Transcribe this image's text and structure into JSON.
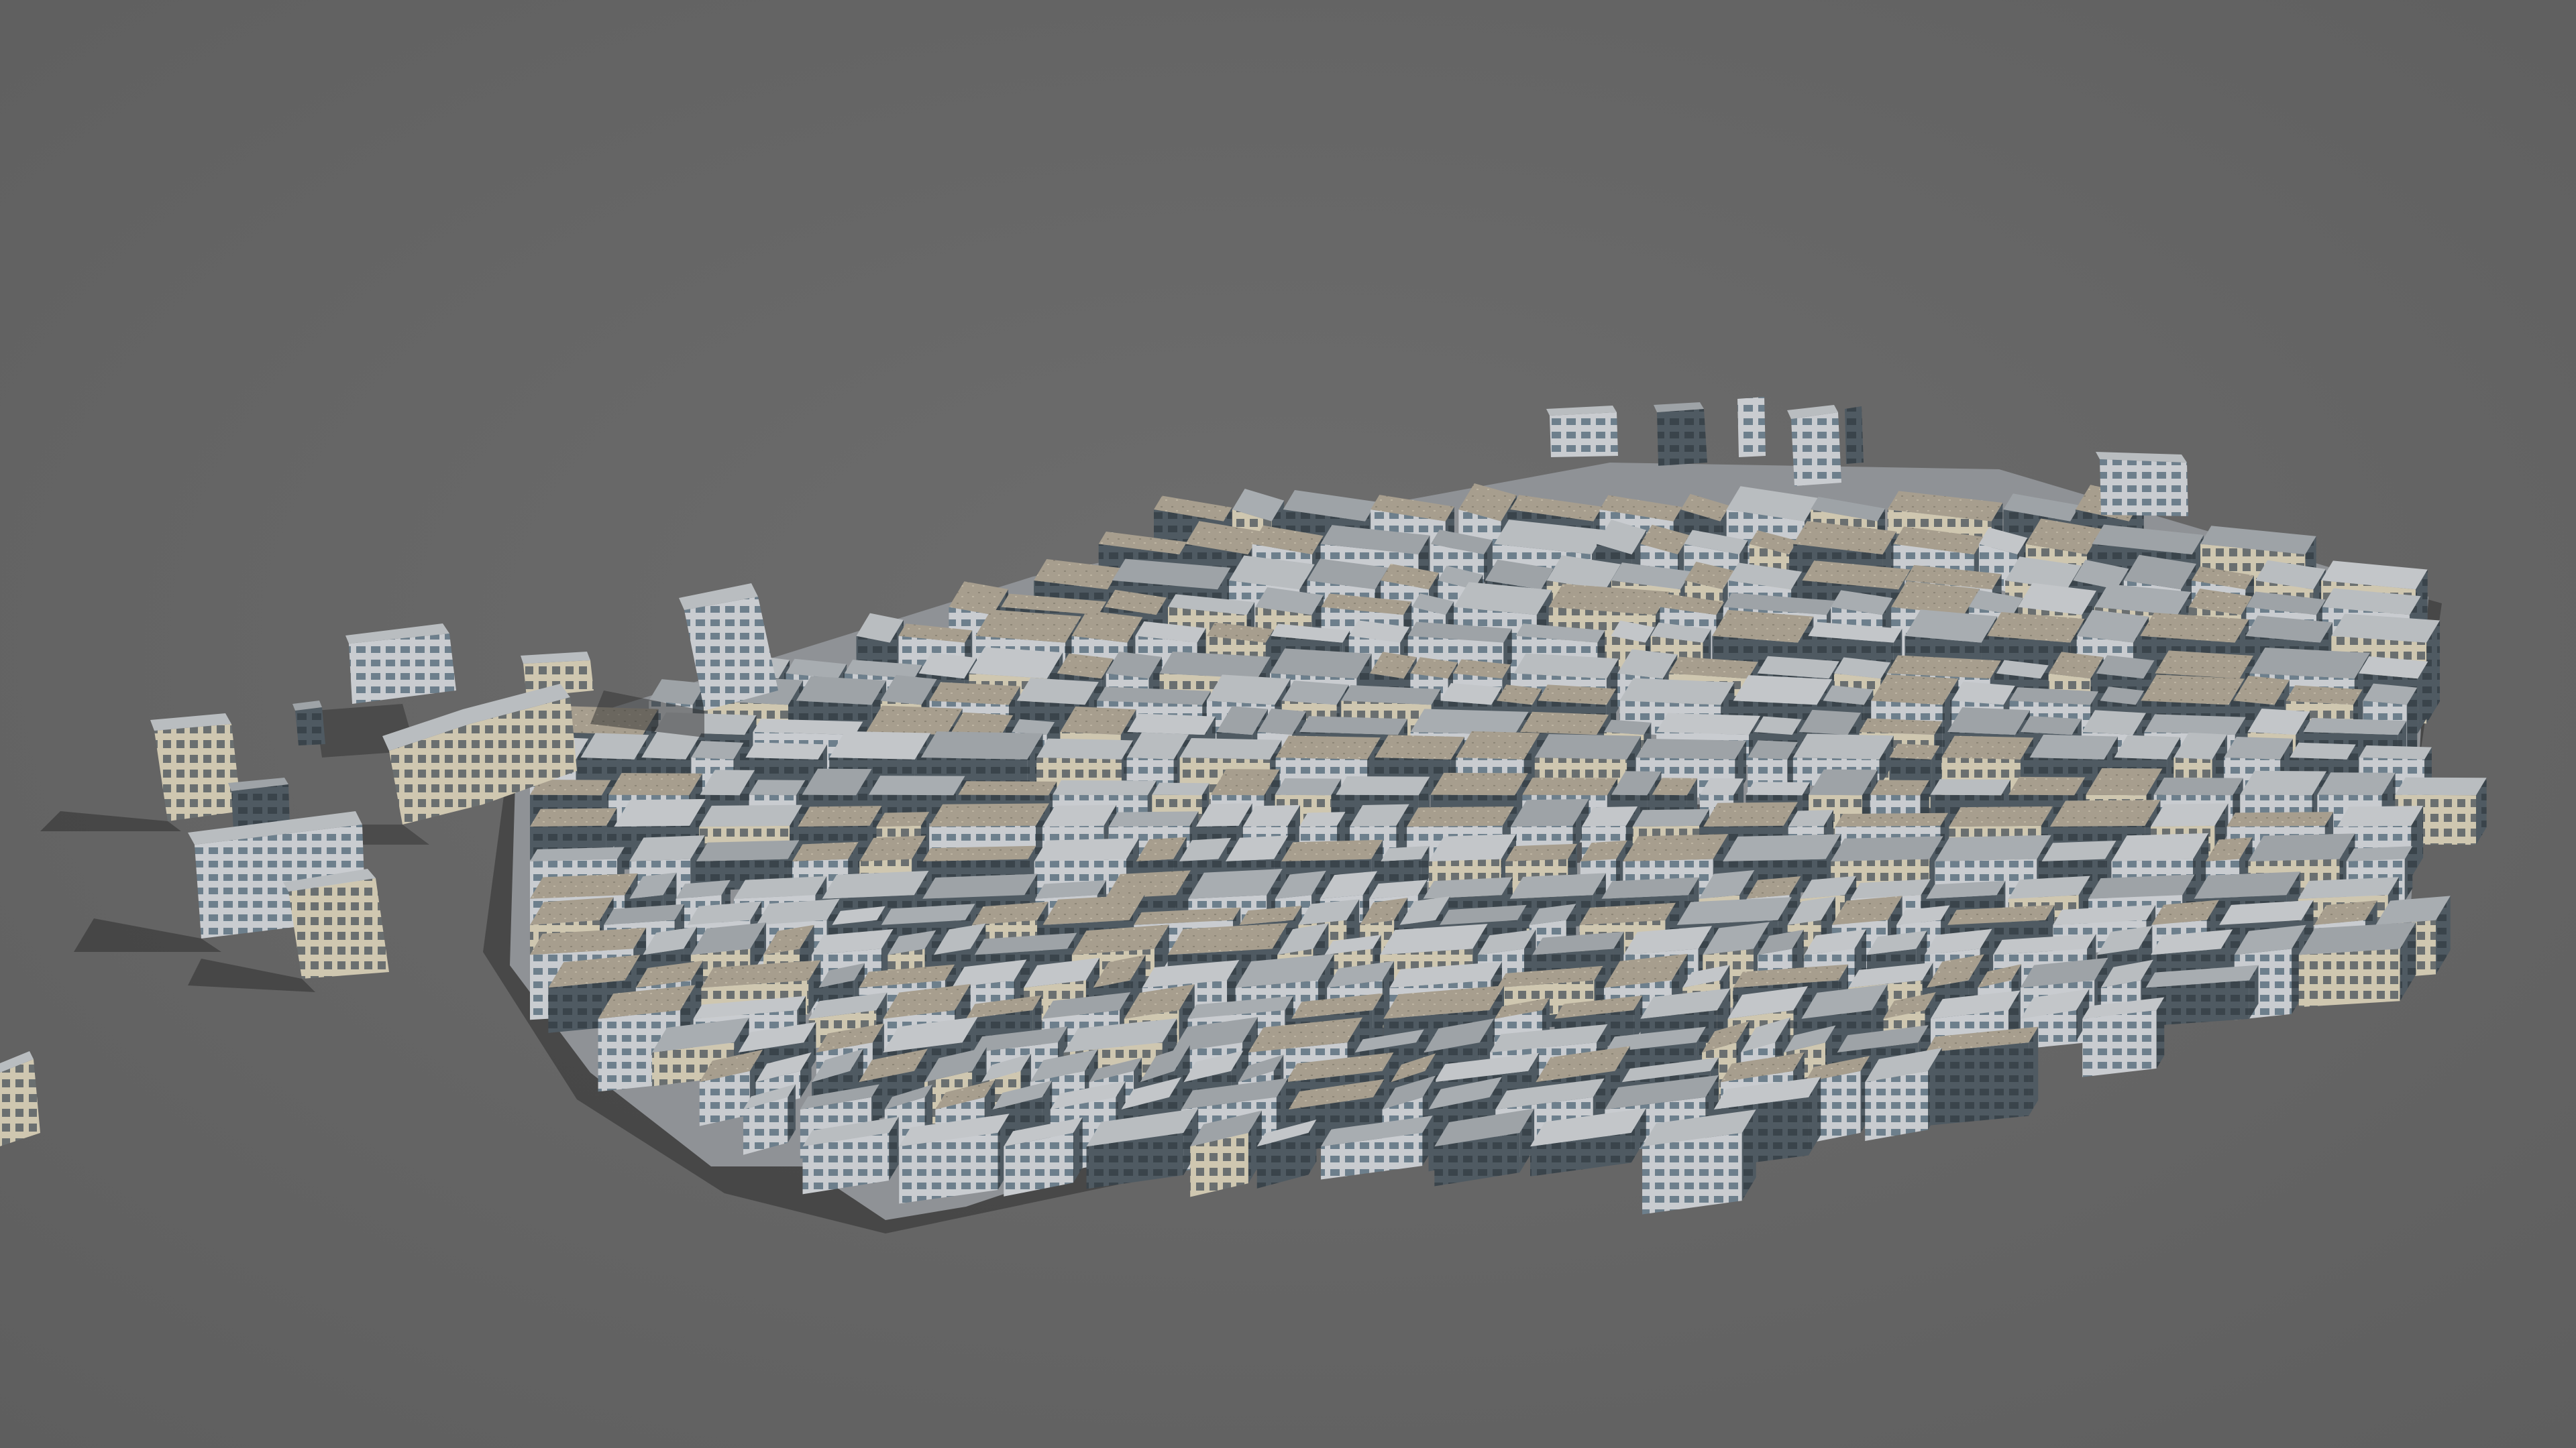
{
  "scene": {
    "description_free": true,
    "colors": {
      "background": "#686868",
      "background_dark": "#5c5c5c",
      "shadow": "#2a2a2a",
      "ground": "#8f9296",
      "roof_light": "#b9bdc0",
      "roof_mid": "#9ea3a7",
      "wall_lit": "#c9ccd0",
      "wall_dark": "#4f5a62",
      "window_tint": "#6d7f8c",
      "brick_accent": "#8c6f6a",
      "gravel_roof": "#a79e8e"
    }
  }
}
